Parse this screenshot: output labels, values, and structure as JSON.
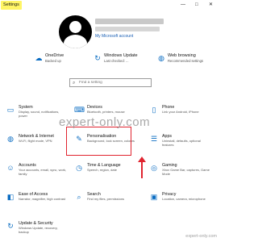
{
  "window": {
    "title": "Settings",
    "controls": {
      "minimize": "—",
      "maximize": "□",
      "close": "✕"
    }
  },
  "account": {
    "link": "My Microsoft account"
  },
  "status": [
    {
      "title": "OneDrive",
      "sub": "Backed up",
      "icon": "cloud-icon"
    },
    {
      "title": "Windows Update",
      "sub": "Last checked: ...",
      "icon": "refresh-icon"
    },
    {
      "title": "Web browsing",
      "sub": "Recommended settings",
      "icon": "globe-icon"
    }
  ],
  "search": {
    "placeholder": "Find a setting"
  },
  "tiles": [
    {
      "name": "System",
      "desc": "Display, sound, notifications, power",
      "icon": "laptop-icon"
    },
    {
      "name": "Devices",
      "desc": "Bluetooth, printers, mouse",
      "icon": "keyboard-icon"
    },
    {
      "name": "Phone",
      "desc": "Link your Android, iPhone",
      "icon": "phone-icon"
    },
    {
      "name": "Network & Internet",
      "desc": "Wi-Fi, flight mode, VPN",
      "icon": "globe-icon"
    },
    {
      "name": "Personalisation",
      "desc": "Background, lock screen, colours",
      "icon": "brush-icon"
    },
    {
      "name": "Apps",
      "desc": "Uninstall, defaults, optional features",
      "icon": "apps-icon"
    },
    {
      "name": "Accounts",
      "desc": "Your accounts, email, sync, work, family",
      "icon": "person-icon"
    },
    {
      "name": "Time & Language",
      "desc": "Speech, region, date",
      "icon": "clock-icon"
    },
    {
      "name": "Gaming",
      "desc": "Xbox Game Bar, captures, Game Mode",
      "icon": "gamepad-icon"
    },
    {
      "name": "Ease of Access",
      "desc": "Narrator, magnifier, high contrast",
      "icon": "accessibility-icon"
    },
    {
      "name": "Search",
      "desc": "Find my files, permissions",
      "icon": "search-icon"
    },
    {
      "name": "Privacy",
      "desc": "Location, camera, microphone",
      "icon": "lock-icon"
    },
    {
      "name": "Update & Security",
      "desc": "Windows Update, recovery, backup",
      "icon": "sync-icon"
    }
  ],
  "watermarks": {
    "center": "expert-only.com",
    "bottom": "expert-only.com"
  },
  "colors": {
    "accent": "#0a6cc2",
    "highlight": "#e0242f",
    "title_highlight": "#fff566"
  }
}
